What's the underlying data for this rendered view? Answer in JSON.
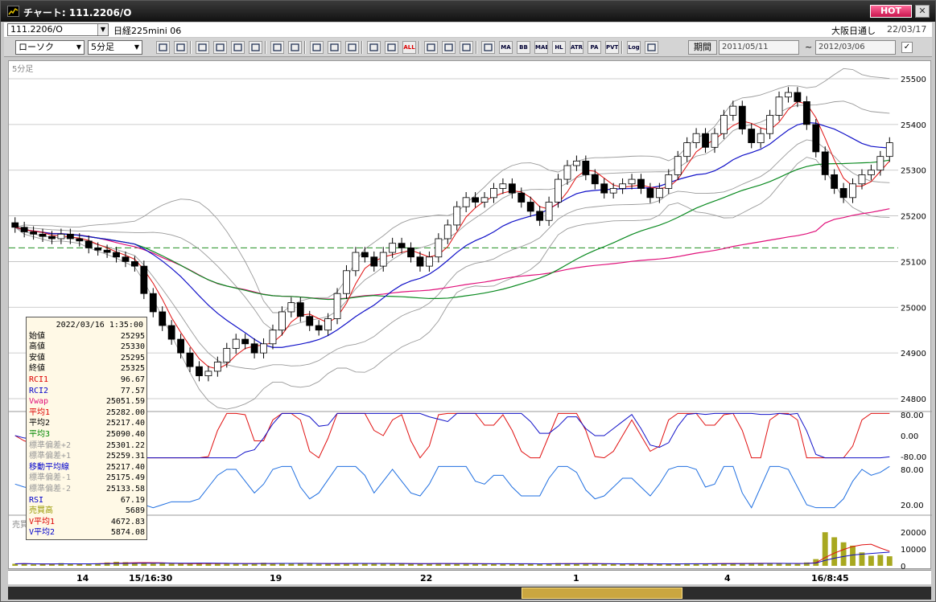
{
  "window": {
    "title": "チャート: 111.2206/O",
    "hot_label": "HOT",
    "close_label": "✕"
  },
  "header": {
    "symbol_value": "111.2206/O",
    "symbol_name": "日経225mini 06",
    "market": "大阪日通し",
    "date": "22/03/17"
  },
  "toolbar": {
    "chart_type": "ローソク",
    "interval": "5分足",
    "buttons": [
      "search",
      "grid",
      "tool",
      "zoom",
      "bars",
      "lines",
      "draw",
      "warn",
      "pencil",
      "cursor",
      "undo",
      "v1",
      "v2",
      "all",
      "gear",
      "wrench",
      "color",
      "tv",
      "MA",
      "BB",
      "MAE",
      "HL",
      "ATR",
      "PARA",
      "PVT",
      "Log",
      "fit"
    ],
    "button_labels": {
      "all": "ALL",
      "MA": "MA",
      "BB": "BB",
      "MAE": "MAE",
      "HL": "HL",
      "ATR": "ATR",
      "PARA": "PA RA",
      "PVT": "PVT",
      "Log": "Log"
    },
    "period_label": "期間",
    "date_from": "2011/05/11",
    "date_to": "2012/03/06",
    "tilde": "~",
    "check": "✓"
  },
  "chart_labels": {
    "interval_label": "5分足",
    "volume_label": "売買高(6,12,24)"
  },
  "colors": {
    "candle_up": "#ffffff",
    "candle_down": "#000000",
    "ma_short": "#e01010",
    "ma_mid": "#1010c8",
    "ma_long": "#0a8a20",
    "vwap": "#e0107a",
    "bb": "#9a9a9a",
    "rci1": "#e01010",
    "rci2": "#1010c8",
    "rsi": "#1e6ee0",
    "volume": "#a8a820",
    "ref_line": "#209020"
  },
  "infobox": {
    "timestamp": "2022/03/16  1:35:00",
    "rows": [
      {
        "label": "始値",
        "value": "25295",
        "color": "#000"
      },
      {
        "label": "高値",
        "value": "25330",
        "color": "#000"
      },
      {
        "label": "安値",
        "value": "25295",
        "color": "#000"
      },
      {
        "label": "終値",
        "value": "25325",
        "color": "#000"
      },
      {
        "label": "RCI1",
        "value": "96.67",
        "color": "#d00"
      },
      {
        "label": "RCI2",
        "value": "77.57",
        "color": "#00c"
      },
      {
        "label": "Vwap",
        "value": "25051.59",
        "color": "#e0107a"
      },
      {
        "label": "平均1",
        "value": "25282.00",
        "color": "#d00"
      },
      {
        "label": "平均2",
        "value": "25217.40",
        "color": "#000"
      },
      {
        "label": "平均3",
        "value": "25090.40",
        "color": "#080"
      },
      {
        "label": "標準偏差+2",
        "value": "25301.22",
        "color": "#999"
      },
      {
        "label": "標準偏差+1",
        "value": "25259.31",
        "color": "#999"
      },
      {
        "label": "移動平均線",
        "value": "25217.40",
        "color": "#00c"
      },
      {
        "label": "標準偏差-1",
        "value": "25175.49",
        "color": "#999"
      },
      {
        "label": "標準偏差-2",
        "value": "25133.58",
        "color": "#999"
      },
      {
        "label": "RSI",
        "value": "67.19",
        "color": "#00c"
      },
      {
        "label": "売買高",
        "value": "5689",
        "color": "#990"
      },
      {
        "label": "V平均1",
        "value": "4672.83",
        "color": "#d00"
      },
      {
        "label": "V平均2",
        "value": "5874.08",
        "color": "#00c"
      }
    ]
  },
  "chart_data": {
    "type": "candlestick",
    "price_axis": {
      "min": 24800,
      "max": 25500,
      "ticks": [
        "25500",
        "25400",
        "25300",
        "25200",
        "25100",
        "25000",
        "24900",
        "24800"
      ]
    },
    "osc_axis": {
      "ticks": [
        "80.00",
        "0.00",
        "-80.00"
      ]
    },
    "rsi_axis": {
      "ticks": [
        "80.00",
        "20.00"
      ]
    },
    "volume_axis": {
      "ticks": [
        "20000",
        "10000",
        "0"
      ]
    },
    "x_labels": [
      "14",
      "15/16:30",
      "19",
      "22",
      "1",
      "4",
      "16/8:45"
    ],
    "reference_level": 25130,
    "close": [
      25175,
      25165,
      25160,
      25155,
      25150,
      25160,
      25150,
      25145,
      25130,
      25125,
      25120,
      25110,
      25100,
      25090,
      25030,
      24990,
      24960,
      24930,
      24900,
      24870,
      24850,
      24860,
      24880,
      24910,
      24930,
      24920,
      24900,
      24920,
      24950,
      24990,
      25010,
      24980,
      24960,
      24950,
      24975,
      25030,
      25080,
      25120,
      25110,
      25090,
      25120,
      25140,
      25130,
      25110,
      25090,
      25110,
      25150,
      25180,
      25220,
      25240,
      25230,
      25240,
      25260,
      25270,
      25250,
      25230,
      25210,
      25190,
      25230,
      25280,
      25310,
      25320,
      25290,
      25270,
      25250,
      25260,
      25270,
      25280,
      25260,
      25240,
      25260,
      25290,
      25330,
      25360,
      25380,
      25350,
      25380,
      25420,
      25440,
      25390,
      25360,
      25380,
      25420,
      25460,
      25470,
      25450,
      25400,
      25340,
      25290,
      25260,
      25240,
      25270,
      25290,
      25300,
      25330,
      25360
    ],
    "volume": [
      1200,
      1400,
      900,
      1000,
      1100,
      1600,
      1300,
      1000,
      1100,
      1500,
      2000,
      2400,
      2200,
      1800,
      1400,
      1300,
      1500,
      1200,
      1200,
      1300,
      1400,
      1600,
      1500,
      1300,
      1200,
      1100,
      1400,
      1800,
      1600,
      1500,
      1300,
      1400,
      1200,
      1100,
      1300,
      1500,
      1400,
      1600,
      1500,
      1300,
      1200,
      1400,
      1300,
      1200,
      1100,
      1300,
      1500,
      1400,
      1300,
      1200,
      1100,
      1000,
      1200,
      1400,
      1300,
      1100,
      1000,
      1200,
      1400,
      1600,
      1500,
      1300,
      1200,
      1100,
      1000,
      1100,
      1200,
      1300,
      1200,
      1100,
      1000,
      1100,
      1300,
      1500,
      1400,
      1300,
      1200,
      1400,
      1600,
      1500,
      1700,
      1500,
      1400,
      1200,
      1300,
      1100,
      2000,
      4000,
      20000,
      17000,
      14000,
      12000,
      8000,
      6000,
      6500,
      5689
    ]
  }
}
